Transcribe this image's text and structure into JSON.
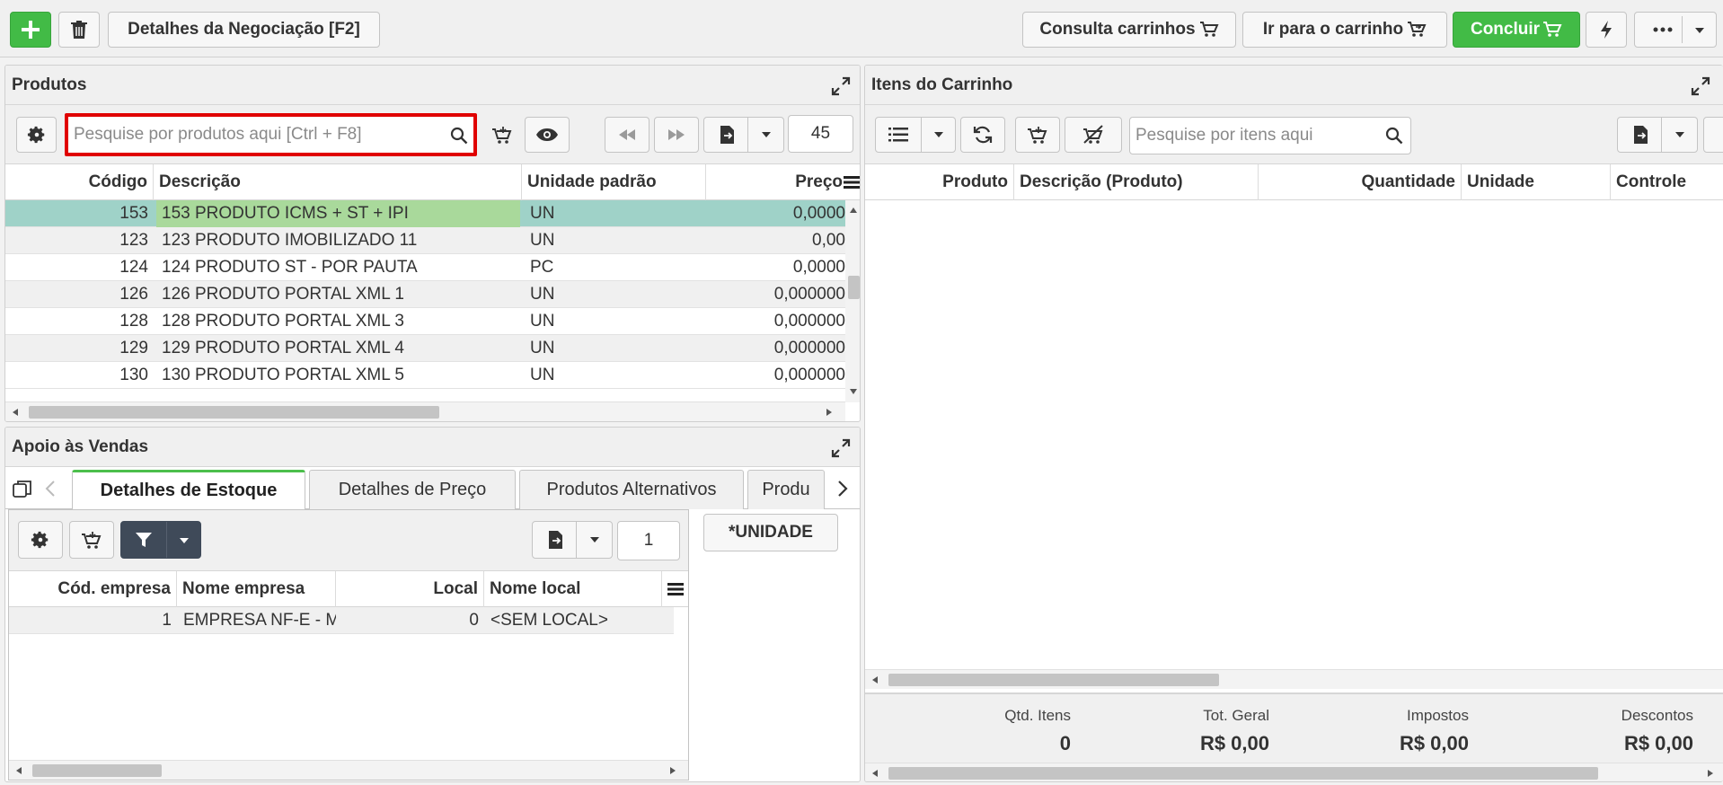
{
  "topbar": {
    "details_label": "Detalhes da Negociação [F2]",
    "consulta_label": "Consulta carrinhos",
    "ir_label": "Ir para o carrinho",
    "concluir_label": "Concluir"
  },
  "produtos": {
    "title": "Produtos",
    "search_placeholder": "Pesquise por produtos aqui [Ctrl + F8]",
    "page_size": "45",
    "columns": [
      "Código",
      "Descrição",
      "Unidade padrão",
      "Preço"
    ],
    "rows": [
      {
        "codigo": "153",
        "descricao": "153 PRODUTO ICMS + ST + IPI",
        "unidade": "UN",
        "preco": "0,0000"
      },
      {
        "codigo": "123",
        "descricao": "123 PRODUTO IMOBILIZADO 11",
        "unidade": "UN",
        "preco": "0,00"
      },
      {
        "codigo": "124",
        "descricao": "124 PRODUTO ST - POR PAUTA",
        "unidade": "PC",
        "preco": "0,0000"
      },
      {
        "codigo": "126",
        "descricao": "126 PRODUTO PORTAL XML 1",
        "unidade": "UN",
        "preco": "0,000000"
      },
      {
        "codigo": "128",
        "descricao": "128 PRODUTO PORTAL XML 3",
        "unidade": "UN",
        "preco": "0,000000"
      },
      {
        "codigo": "129",
        "descricao": "129 PRODUTO PORTAL XML 4",
        "unidade": "UN",
        "preco": "0,000000"
      },
      {
        "codigo": "130",
        "descricao": "130 PRODUTO PORTAL XML 5",
        "unidade": "UN",
        "preco": "0,000000"
      }
    ]
  },
  "apoio": {
    "title": "Apoio às Vendas",
    "tabs": [
      "Detalhes de Estoque",
      "Detalhes de Preço",
      "Produtos Alternativos",
      "Produ"
    ],
    "page_size": "1",
    "unidade_label": "*UNIDADE",
    "columns": [
      "Cód. empresa",
      "Nome empresa",
      "Local",
      "Nome local"
    ],
    "rows": [
      {
        "cod": "1",
        "nome": "EMPRESA NF-E - M",
        "local": "0",
        "nome_local": "<SEM LOCAL>"
      }
    ]
  },
  "carrinho": {
    "title": "Itens do Carrinho",
    "search_placeholder": "Pesquise por itens aqui",
    "columns": [
      "Produto",
      "Descrição (Produto)",
      "Quantidade",
      "Unidade",
      "Controle"
    ],
    "summary": [
      {
        "label": "Qtd. Itens",
        "value": "0"
      },
      {
        "label": "Tot. Geral",
        "value": "R$ 0,00"
      },
      {
        "label": "Impostos",
        "value": "R$ 0,00"
      },
      {
        "label": "Descontos",
        "value": "R$ 0,00"
      }
    ]
  },
  "colors": {
    "accent_green": "#42bb46",
    "highlight_red": "#e00000",
    "selected_row": "#9fd2c8",
    "selected_desc": "#a9d99b"
  }
}
